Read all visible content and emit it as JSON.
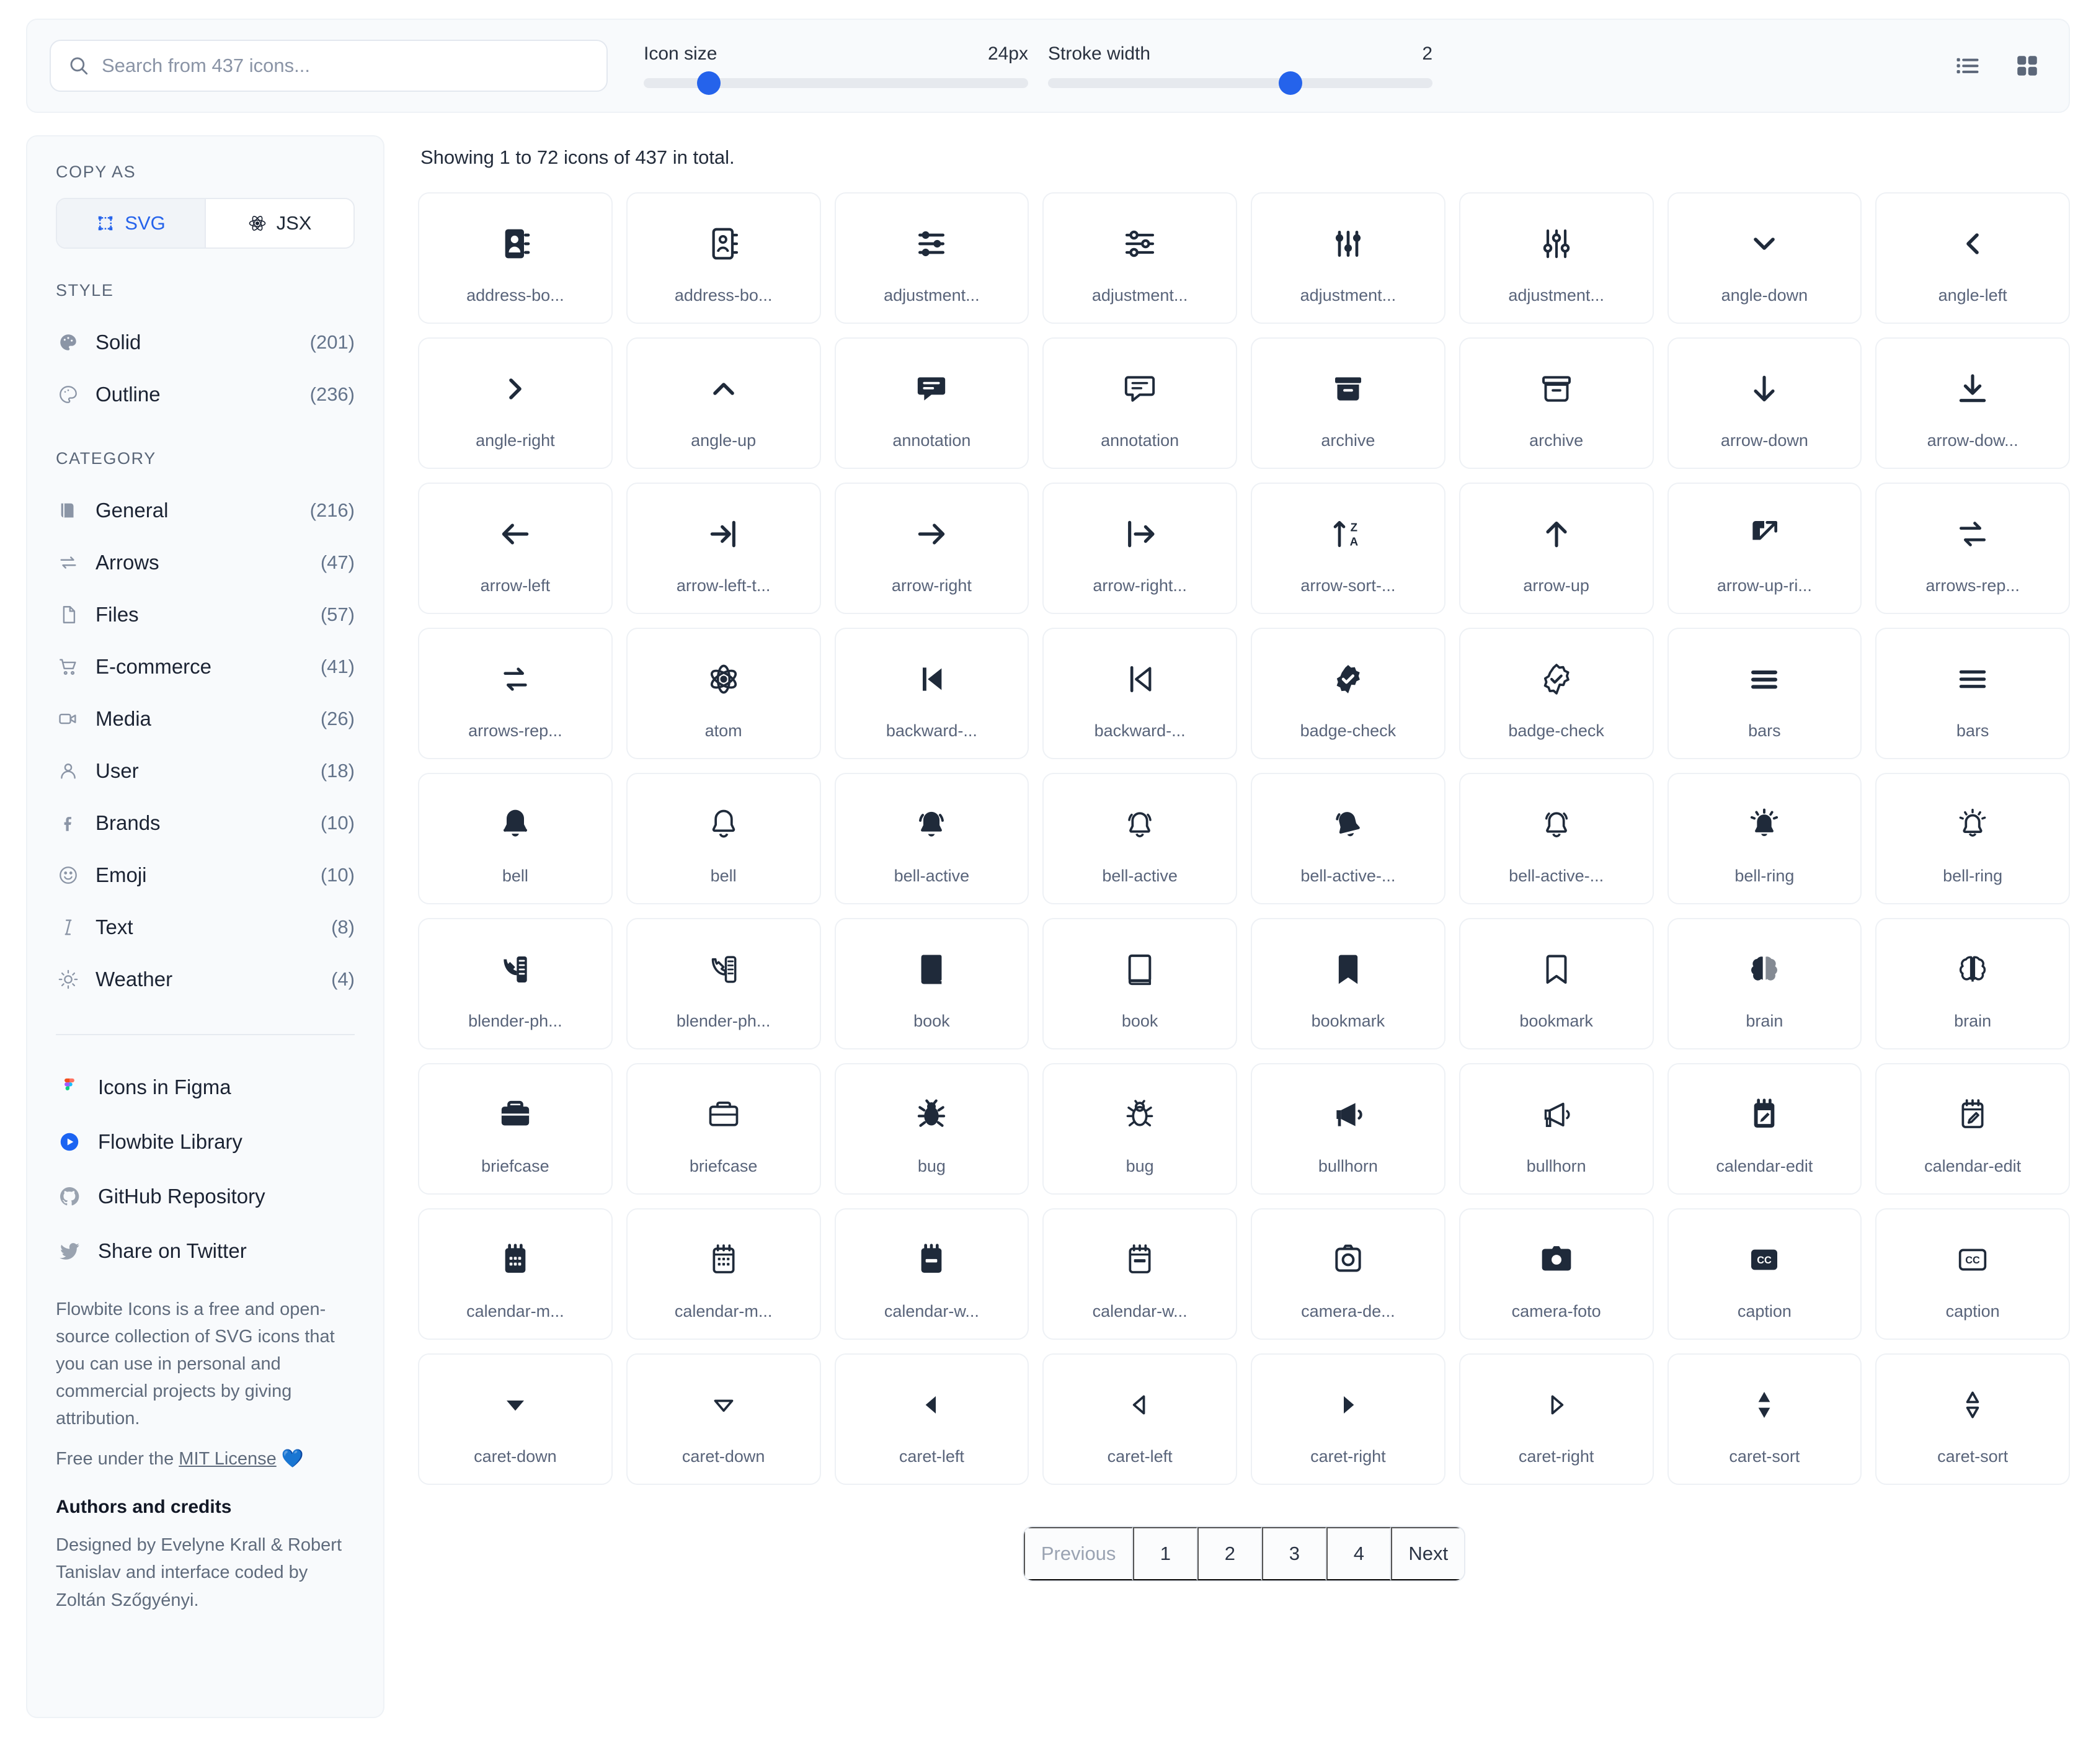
{
  "toolbar": {
    "search_placeholder": "Search from 437 icons...",
    "search_value": "",
    "icon_size_label": "Icon size",
    "icon_size_value": "24px",
    "stroke_width_label": "Stroke width",
    "stroke_width_value": "2",
    "icon_size_pct": 17,
    "stroke_width_pct": 63,
    "accent": "#2563eb"
  },
  "sidebar": {
    "copy_as_title": "COPY AS",
    "copy_as": [
      {
        "label": "SVG",
        "icon": "vector-square-icon",
        "active": true
      },
      {
        "label": "JSX",
        "icon": "react-atom-icon",
        "active": false
      }
    ],
    "style_title": "STYLE",
    "styles": [
      {
        "label": "Solid",
        "count": "(201)",
        "icon": "palette-solid-icon"
      },
      {
        "label": "Outline",
        "count": "(236)",
        "icon": "palette-outline-icon"
      }
    ],
    "category_title": "CATEGORY",
    "categories": [
      {
        "label": "General",
        "count": "(216)",
        "icon": "book-icon"
      },
      {
        "label": "Arrows",
        "count": "(47)",
        "icon": "arrows-repeat-icon"
      },
      {
        "label": "Files",
        "count": "(57)",
        "icon": "file-icon"
      },
      {
        "label": "E-commerce",
        "count": "(41)",
        "icon": "cart-icon"
      },
      {
        "label": "Media",
        "count": "(26)",
        "icon": "video-camera-icon"
      },
      {
        "label": "User",
        "count": "(18)",
        "icon": "user-icon"
      },
      {
        "label": "Brands",
        "count": "(10)",
        "icon": "facebook-f-icon"
      },
      {
        "label": "Emoji",
        "count": "(10)",
        "icon": "smile-icon"
      },
      {
        "label": "Text",
        "count": "(8)",
        "icon": "italic-icon"
      },
      {
        "label": "Weather",
        "count": "(4)",
        "icon": "sun-icon"
      }
    ],
    "links": [
      {
        "label": "Icons in Figma",
        "icon": "figma-icon"
      },
      {
        "label": "Flowbite Library",
        "icon": "flowbite-icon"
      },
      {
        "label": "GitHub Repository",
        "icon": "github-icon"
      },
      {
        "label": "Share on Twitter",
        "icon": "twitter-icon"
      }
    ],
    "blurb": "Flowbite Icons is a free and open-source collection of SVG icons that you can use in personal and commercial projects by giving attribution.",
    "license_prefix": "Free under the ",
    "license_link": "MIT License",
    "license_suffix": " 💙",
    "credits_heading": "Authors and credits",
    "credits_body": "Designed by Evelyne Krall & Robert Tanislav and interface coded by Zoltán Szőgyényi."
  },
  "main": {
    "showing": "Showing 1 to 72 icons of 437 in total.",
    "icons": [
      {
        "name": "address-bo...",
        "glyph": "address-book-solid-icon"
      },
      {
        "name": "address-bo...",
        "glyph": "address-book-outline-icon"
      },
      {
        "name": "adjustment...",
        "glyph": "adjustments-horizontal-solid-icon"
      },
      {
        "name": "adjustment...",
        "glyph": "adjustments-horizontal-outline-icon"
      },
      {
        "name": "adjustment...",
        "glyph": "adjustments-vertical-solid-icon"
      },
      {
        "name": "adjustment...",
        "glyph": "adjustments-vertical-outline-icon"
      },
      {
        "name": "angle-down",
        "glyph": "angle-down-icon"
      },
      {
        "name": "angle-left",
        "glyph": "angle-left-icon"
      },
      {
        "name": "angle-right",
        "glyph": "angle-right-icon"
      },
      {
        "name": "angle-up",
        "glyph": "angle-up-icon"
      },
      {
        "name": "annotation",
        "glyph": "annotation-solid-icon"
      },
      {
        "name": "annotation",
        "glyph": "annotation-outline-icon"
      },
      {
        "name": "archive",
        "glyph": "archive-solid-icon"
      },
      {
        "name": "archive",
        "glyph": "archive-outline-icon"
      },
      {
        "name": "arrow-down",
        "glyph": "arrow-down-icon"
      },
      {
        "name": "arrow-dow...",
        "glyph": "arrow-download-icon"
      },
      {
        "name": "arrow-left",
        "glyph": "arrow-left-icon"
      },
      {
        "name": "arrow-left-t...",
        "glyph": "arrow-left-to-bracket-icon"
      },
      {
        "name": "arrow-right",
        "glyph": "arrow-right-icon"
      },
      {
        "name": "arrow-right...",
        "glyph": "arrow-right-from-bracket-icon"
      },
      {
        "name": "arrow-sort-...",
        "glyph": "arrow-sort-letters-icon"
      },
      {
        "name": "arrow-up",
        "glyph": "arrow-up-icon"
      },
      {
        "name": "arrow-up-ri...",
        "glyph": "arrow-up-right-box-icon"
      },
      {
        "name": "arrows-rep...",
        "glyph": "arrows-repeat-outline-icon"
      },
      {
        "name": "arrows-rep...",
        "glyph": "arrows-repeat-count-icon"
      },
      {
        "name": "atom",
        "glyph": "atom-icon"
      },
      {
        "name": "backward-...",
        "glyph": "backward-step-solid-icon"
      },
      {
        "name": "backward-...",
        "glyph": "backward-step-outline-icon"
      },
      {
        "name": "badge-check",
        "glyph": "badge-check-solid-icon"
      },
      {
        "name": "badge-check",
        "glyph": "badge-check-outline-icon"
      },
      {
        "name": "bars",
        "glyph": "bars-solid-icon"
      },
      {
        "name": "bars",
        "glyph": "bars-outline-icon"
      },
      {
        "name": "bell",
        "glyph": "bell-solid-icon"
      },
      {
        "name": "bell",
        "glyph": "bell-outline-icon"
      },
      {
        "name": "bell-active",
        "glyph": "bell-active-solid-icon"
      },
      {
        "name": "bell-active",
        "glyph": "bell-active-outline-icon"
      },
      {
        "name": "bell-active-...",
        "glyph": "bell-active-alt-solid-icon"
      },
      {
        "name": "bell-active-...",
        "glyph": "bell-active-alt-outline-icon"
      },
      {
        "name": "bell-ring",
        "glyph": "bell-ring-solid-icon"
      },
      {
        "name": "bell-ring",
        "glyph": "bell-ring-outline-icon"
      },
      {
        "name": "blender-ph...",
        "glyph": "blender-phone-solid-icon"
      },
      {
        "name": "blender-ph...",
        "glyph": "blender-phone-outline-icon"
      },
      {
        "name": "book",
        "glyph": "book-solid-icon"
      },
      {
        "name": "book",
        "glyph": "book-outline-icon"
      },
      {
        "name": "bookmark",
        "glyph": "bookmark-solid-icon"
      },
      {
        "name": "bookmark",
        "glyph": "bookmark-outline-icon"
      },
      {
        "name": "brain",
        "glyph": "brain-solid-icon"
      },
      {
        "name": "brain",
        "glyph": "brain-outline-icon"
      },
      {
        "name": "briefcase",
        "glyph": "briefcase-solid-icon"
      },
      {
        "name": "briefcase",
        "glyph": "briefcase-outline-icon"
      },
      {
        "name": "bug",
        "glyph": "bug-solid-icon"
      },
      {
        "name": "bug",
        "glyph": "bug-outline-icon"
      },
      {
        "name": "bullhorn",
        "glyph": "bullhorn-solid-icon"
      },
      {
        "name": "bullhorn",
        "glyph": "bullhorn-outline-icon"
      },
      {
        "name": "calendar-edit",
        "glyph": "calendar-edit-solid-icon"
      },
      {
        "name": "calendar-edit",
        "glyph": "calendar-edit-outline-icon"
      },
      {
        "name": "calendar-m...",
        "glyph": "calendar-month-solid-icon"
      },
      {
        "name": "calendar-m...",
        "glyph": "calendar-month-outline-icon"
      },
      {
        "name": "calendar-w...",
        "glyph": "calendar-week-solid-icon"
      },
      {
        "name": "calendar-w...",
        "glyph": "calendar-week-outline-icon"
      },
      {
        "name": "camera-de...",
        "glyph": "camera-device-icon"
      },
      {
        "name": "camera-foto",
        "glyph": "camera-foto-icon"
      },
      {
        "name": "caption",
        "glyph": "caption-solid-icon"
      },
      {
        "name": "caption",
        "glyph": "caption-outline-icon"
      },
      {
        "name": "caret-down",
        "glyph": "caret-down-solid-icon"
      },
      {
        "name": "caret-down",
        "glyph": "caret-down-outline-icon"
      },
      {
        "name": "caret-left",
        "glyph": "caret-left-solid-icon"
      },
      {
        "name": "caret-left",
        "glyph": "caret-left-outline-icon"
      },
      {
        "name": "caret-right",
        "glyph": "caret-right-solid-icon"
      },
      {
        "name": "caret-right",
        "glyph": "caret-right-outline-icon"
      },
      {
        "name": "caret-sort",
        "glyph": "caret-sort-solid-icon"
      },
      {
        "name": "caret-sort",
        "glyph": "caret-sort-outline-icon"
      }
    ]
  },
  "pagination": {
    "previous": "Previous",
    "pages": [
      "1",
      "2",
      "3",
      "4"
    ],
    "next": "Next"
  }
}
